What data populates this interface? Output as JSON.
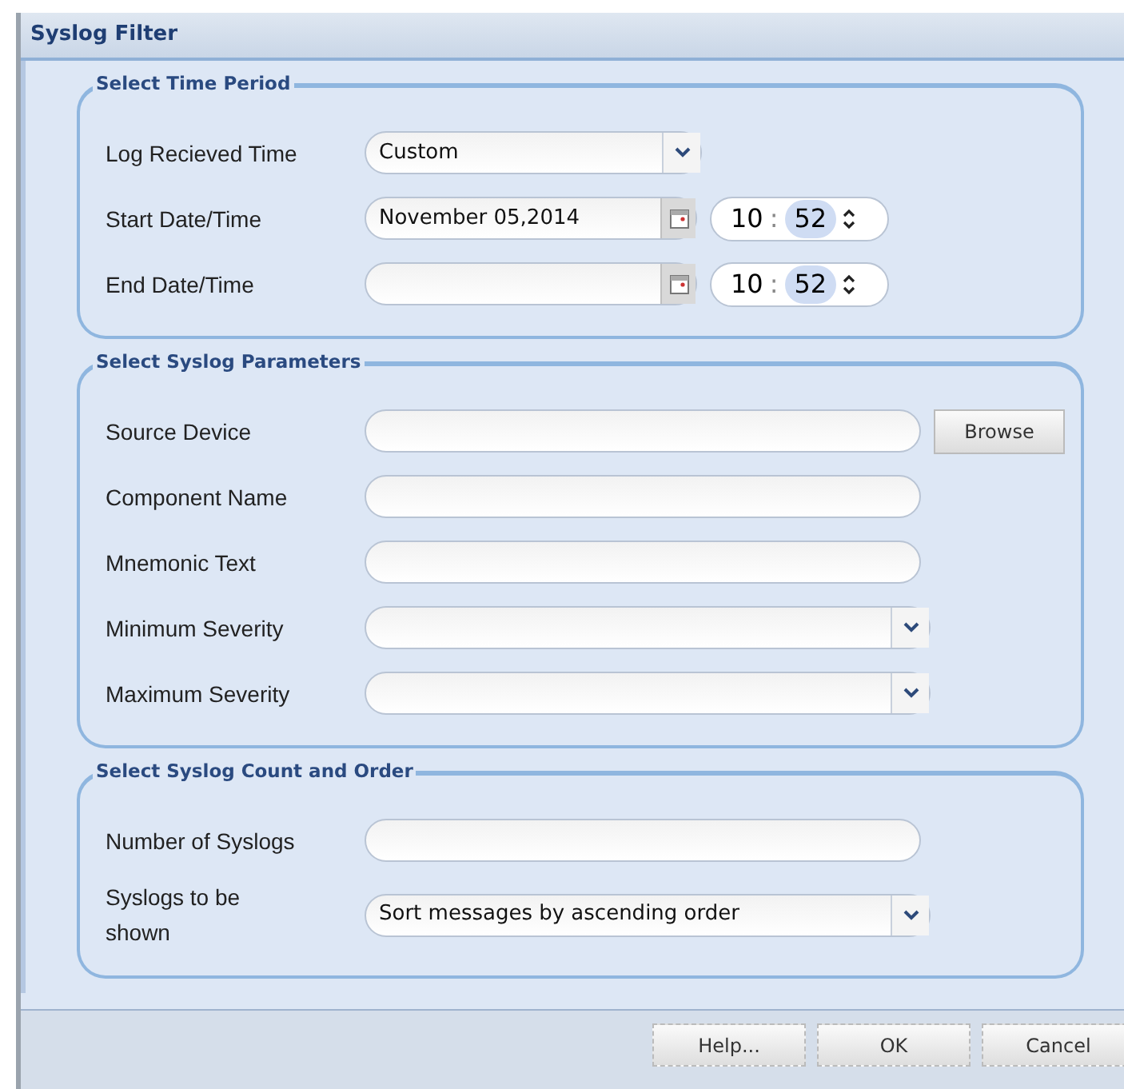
{
  "window": {
    "title": "Syslog Filter"
  },
  "sections": [
    {
      "legend": "Select Time Period",
      "fields": [
        {
          "kind": "select",
          "label": "Log Recieved Time",
          "value": "Custom"
        },
        {
          "kind": "datetime",
          "label": "Start Date/Time",
          "value": "November 05,2014",
          "hour": "10",
          "separator": ":",
          "minute": "52"
        },
        {
          "kind": "datetime",
          "label": "End Date/Time",
          "hour": "10",
          "separator": ":",
          "minute": "52"
        }
      ]
    },
    {
      "legend": "Select Syslog Parameters",
      "fields": [
        {
          "kind": "browse",
          "label": "Source Device",
          "button": "Browse"
        },
        {
          "kind": "text",
          "label": "Component Name"
        },
        {
          "kind": "text",
          "label": "Mnemonic Text"
        },
        {
          "kind": "wideselect",
          "label": "Minimum Severity"
        },
        {
          "kind": "wideselect",
          "label": "Maximum Severity"
        }
      ]
    },
    {
      "legend": "Select Syslog Count and Order",
      "fields": [
        {
          "kind": "text",
          "label": "Number of Syslogs"
        },
        {
          "kind": "wideselect",
          "label": "Syslogs to be shown",
          "value": "Sort messages by ascending order"
        }
      ]
    }
  ],
  "buttons": [
    "Help...",
    "OK",
    "Cancel"
  ]
}
